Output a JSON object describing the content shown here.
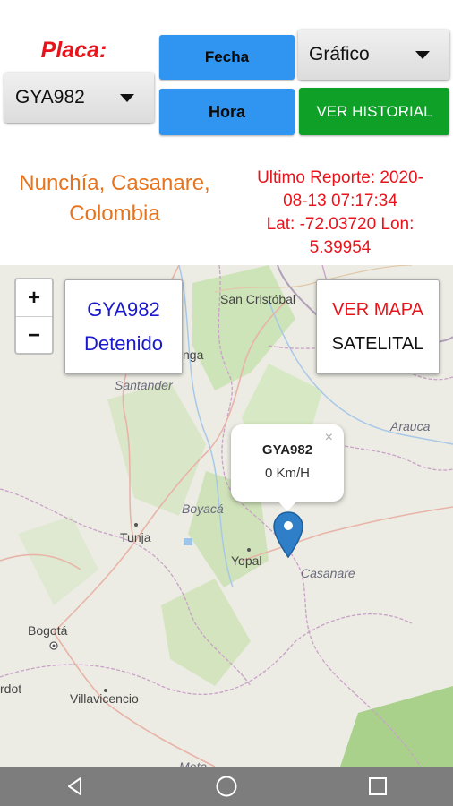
{
  "header": {
    "placa_label": "Placa:",
    "placa_value": "GYA982",
    "fecha_label": "Fecha",
    "hora_label": "Hora",
    "grafico_value": "Gráfico",
    "historial_label": "VER HISTORIAL"
  },
  "info": {
    "location": "Nunchía, Casanare, Colombia",
    "report_line1": "Ultimo Reporte: 2020-",
    "report_line2": "08-13 07:17:34",
    "report_line3": "Lat: -72.03720 Lon:",
    "report_line4": "5.39954"
  },
  "map": {
    "zoom_in": "+",
    "zoom_out": "−",
    "vehicle_plate": "GYA982",
    "vehicle_status": "Detenido",
    "map_button_line1": "VER MAPA",
    "map_button_line2": "SATELITAL",
    "popup_title": "GYA982",
    "popup_speed": "0 Km/H",
    "popup_close": "×",
    "labels": {
      "san_cristobal": "San Cristóbal",
      "nga": "nga",
      "santander": "Santander",
      "arauca": "Arauca",
      "boyaca": "Boyacá",
      "tunja": "Tunja",
      "yopal": "Yopal",
      "casanare": "Casanare",
      "bogota": "Bogotá",
      "rdot": "rdot",
      "villavicencio": "Villavicencio",
      "meta": "Meta"
    },
    "colors": {
      "pin": "#2f7fc8",
      "border_road": "#c9a0c8",
      "green": "#b7d9a0"
    }
  },
  "icons": {
    "back": "back-icon",
    "home": "home-icon",
    "recents": "recents-icon"
  }
}
